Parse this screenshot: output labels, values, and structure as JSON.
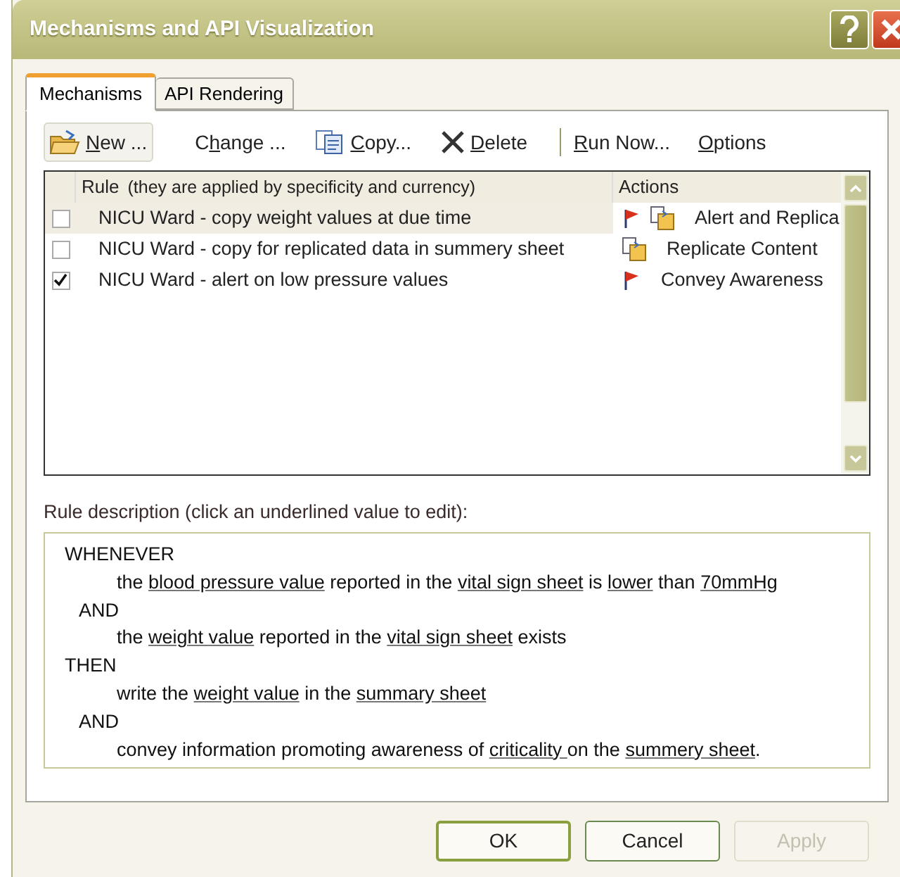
{
  "window": {
    "title": "Mechanisms and API Visualization"
  },
  "tabs": [
    {
      "label": "Mechanisms",
      "selected": true
    },
    {
      "label": "API Rendering",
      "selected": false
    }
  ],
  "toolbar": [
    {
      "kind": "new",
      "key": "N",
      "after": "ew ...",
      "raised": true
    },
    {
      "kind": "change",
      "before": "C",
      "key": "h",
      "after": "ange ...",
      "raised": false
    },
    {
      "kind": "copy",
      "key": "C",
      "after": "opy...",
      "raised": false
    },
    {
      "kind": "delete",
      "key": "D",
      "after": "elete",
      "raised": false
    },
    {
      "kind": "separator"
    },
    {
      "kind": "run",
      "key": "R",
      "after": "un  Now...",
      "raised": false
    },
    {
      "kind": "options",
      "key": "O",
      "after": "ptions",
      "raised": false
    }
  ],
  "rules_table": {
    "columns": [
      "Rule",
      "(they are applied by specificity and currency)",
      "Actions"
    ],
    "rows": [
      {
        "checked": false,
        "selected": true,
        "name": "NICU Ward - copy weight values at due time",
        "kind": "alert_replicate",
        "action": "Alert and Replica"
      },
      {
        "checked": false,
        "selected": false,
        "name": "NICU Ward - copy for replicated data in summery sheet",
        "kind": "replicate",
        "action": "Replicate Content"
      },
      {
        "checked": true,
        "selected": false,
        "name": "NICU Ward - alert on low pressure values",
        "kind": "alert",
        "action": "Convey Awareness"
      }
    ]
  },
  "description": {
    "label": "Rule description (click an underlined value to edit):",
    "lines": [
      {
        "kind": "keyword",
        "parts": [
          {
            "text": "WHENEVER",
            "link": false
          }
        ]
      },
      {
        "kind": "clause",
        "parts": [
          {
            "text": "the ",
            "link": false
          },
          {
            "text": "blood pressure value",
            "link": true
          },
          {
            "text": " reported in the ",
            "link": false
          },
          {
            "text": "vital sign sheet",
            "link": true
          },
          {
            "text": " is ",
            "link": false
          },
          {
            "text": "lower",
            "link": true
          },
          {
            "text": " than ",
            "link": false
          },
          {
            "text": "70mmHg",
            "link": true
          }
        ]
      },
      {
        "kind": "conjunction",
        "parts": [
          {
            "text": "AND",
            "link": false
          }
        ]
      },
      {
        "kind": "clause",
        "parts": [
          {
            "text": "the ",
            "link": false
          },
          {
            "text": "weight value",
            "link": true
          },
          {
            "text": " reported in the ",
            "link": false
          },
          {
            "text": "vital sign sheet",
            "link": true
          },
          {
            "text": " exists",
            "link": false
          }
        ]
      },
      {
        "kind": "keyword",
        "parts": [
          {
            "text": "THEN",
            "link": false
          }
        ]
      },
      {
        "kind": "clause",
        "parts": [
          {
            "text": "write the ",
            "link": false
          },
          {
            "text": "weight value",
            "link": true
          },
          {
            "text": " in the ",
            "link": false
          },
          {
            "text": "summary sheet",
            "link": true
          }
        ]
      },
      {
        "kind": "conjunction",
        "parts": [
          {
            "text": "AND",
            "link": false
          }
        ]
      },
      {
        "kind": "clause",
        "parts": [
          {
            "text": "convey information promoting awareness of ",
            "link": false
          },
          {
            "text": "criticality ",
            "link": true
          },
          {
            "text": "on the ",
            "link": false
          },
          {
            "text": "summery sheet",
            "link": true
          },
          {
            "text": ".",
            "link": false
          }
        ]
      }
    ]
  },
  "buttons": [
    {
      "label": "OK",
      "default": true,
      "disabled": false
    },
    {
      "label": "Cancel",
      "default": false,
      "disabled": false
    },
    {
      "label": "Apply",
      "default": false,
      "disabled": true
    }
  ]
}
